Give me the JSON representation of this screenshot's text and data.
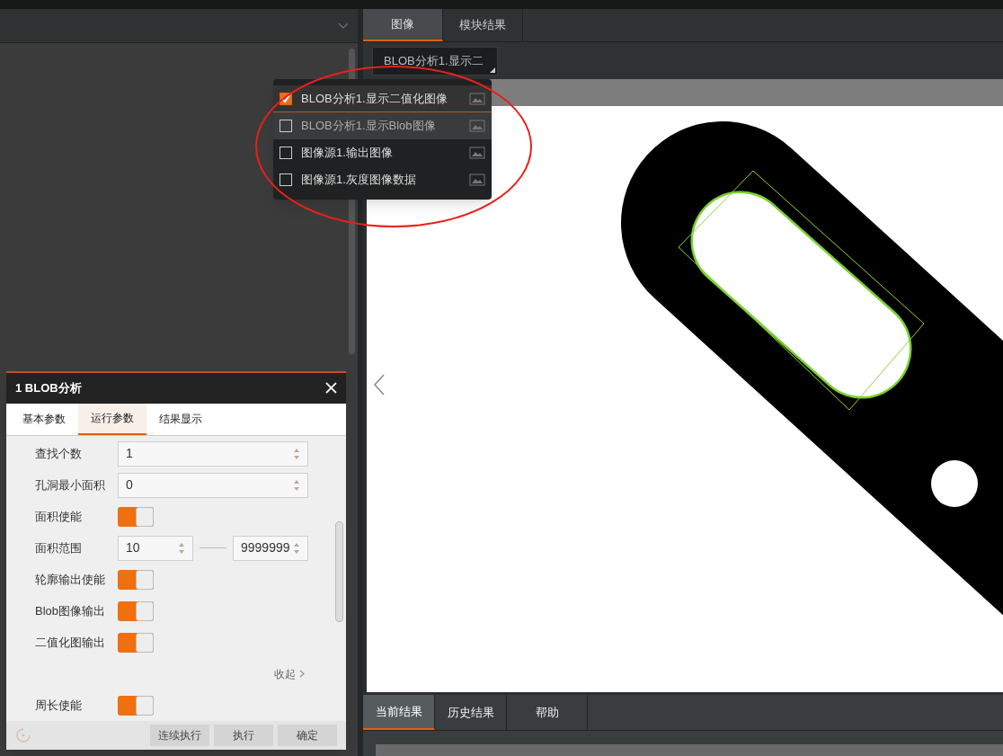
{
  "image_panel": {
    "tabs": [
      {
        "label": "图像",
        "selected": true
      },
      {
        "label": "模块结果",
        "selected": false
      }
    ],
    "source_dropdown": {
      "value": "BLOB分析1.显示二"
    }
  },
  "image_menu": {
    "items": [
      {
        "label": "BLOB分析1.显示二值化图像",
        "checked": true,
        "highlighted": false
      },
      {
        "label": "BLOB分析1.显示Blob图像",
        "checked": false,
        "highlighted": true
      },
      {
        "label": "图像源1.输出图像",
        "checked": false,
        "highlighted": false
      },
      {
        "label": "图像源1.灰度图像数据",
        "checked": false,
        "highlighted": false
      }
    ]
  },
  "result_tabs": [
    {
      "label": "当前结果",
      "selected": true
    },
    {
      "label": "历史结果",
      "selected": false
    },
    {
      "label": "帮助",
      "selected": false
    }
  ],
  "dialog": {
    "title": "1 BLOB分析",
    "tabs": [
      {
        "label": "基本参数",
        "selected": false
      },
      {
        "label": "运行参数",
        "selected": true
      },
      {
        "label": "结果显示",
        "selected": false
      }
    ],
    "rows": [
      {
        "kind": "number",
        "label": "查找个数",
        "value": "1"
      },
      {
        "kind": "number",
        "label": "孔洞最小面积",
        "value": "0"
      },
      {
        "kind": "toggle",
        "label": "面积使能",
        "on": true
      },
      {
        "kind": "range",
        "label": "面积范围",
        "min": "10",
        "max": "9999999"
      },
      {
        "kind": "toggle",
        "label": "轮廓输出使能",
        "on": true
      },
      {
        "kind": "toggle",
        "label": "Blob图像输出",
        "on": true
      },
      {
        "kind": "toggle",
        "label": "二值化图输出",
        "on": true
      },
      {
        "kind": "link",
        "label": "收起"
      },
      {
        "kind": "toggle",
        "label": "周长使能",
        "on": true
      }
    ],
    "buttons": [
      "连续执行",
      "执行",
      "确定"
    ]
  }
}
